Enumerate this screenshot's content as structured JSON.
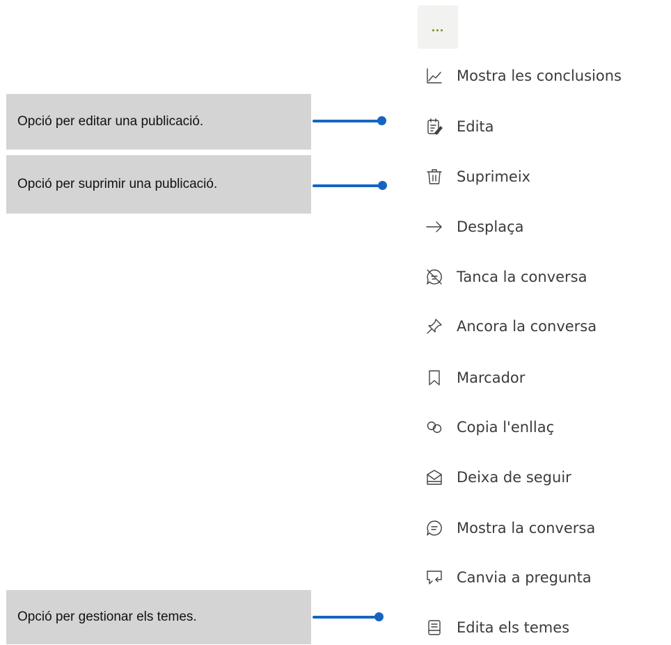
{
  "more_button": {
    "label": "...",
    "accent": "#6a8e1e"
  },
  "menu": {
    "items": [
      {
        "label": "Mostra les conclusions",
        "icon": "chart-line-icon"
      },
      {
        "label": "Edita",
        "icon": "edit-note-icon"
      },
      {
        "label": "Suprimeix",
        "icon": "trash-icon"
      },
      {
        "label": "Desplaça",
        "icon": "arrow-right-icon"
      },
      {
        "label": "Tanca la conversa",
        "icon": "chat-closed-icon"
      },
      {
        "label": "Ancora la conversa",
        "icon": "pin-icon"
      },
      {
        "label": "Marcador",
        "icon": "bookmark-icon"
      },
      {
        "label": "Copia l'enllaç",
        "icon": "link-icon"
      },
      {
        "label": "Deixa de seguir",
        "icon": "unfollow-inbox-icon"
      },
      {
        "label": "Mostra la conversa",
        "icon": "chat-icon"
      },
      {
        "label": "Canvia a pregunta",
        "icon": "switch-question-icon"
      },
      {
        "label": "Edita els temes",
        "icon": "topics-icon"
      }
    ]
  },
  "callouts": [
    {
      "text": "Opció per editar una publicació."
    },
    {
      "text": "Opció per suprimir una publicació."
    },
    {
      "text": "Opció per gestionar els temes."
    }
  ],
  "colors": {
    "callout_bg": "#d4d4d4",
    "connector": "#1565c0"
  }
}
